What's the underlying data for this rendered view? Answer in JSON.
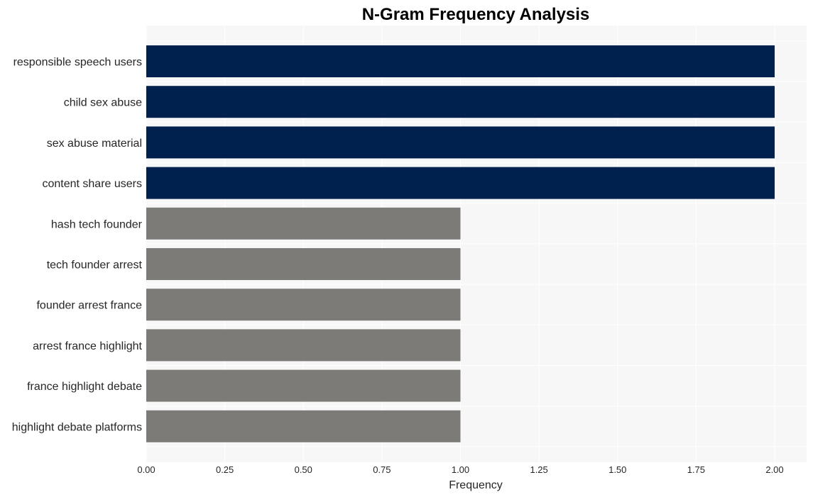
{
  "chart_data": {
    "type": "bar",
    "orientation": "horizontal",
    "title": "N-Gram Frequency Analysis",
    "xlabel": "Frequency",
    "ylabel": "",
    "xlim": [
      0,
      2.1
    ],
    "xticks": [
      0,
      0.25,
      0.5,
      0.75,
      1.0,
      1.25,
      1.5,
      1.75,
      2.0
    ],
    "xtick_labels": [
      "0.00",
      "0.25",
      "0.50",
      "0.75",
      "1.00",
      "1.25",
      "1.50",
      "1.75",
      "2.00"
    ],
    "grid": true,
    "categories": [
      "responsible speech users",
      "child sex abuse",
      "sex abuse material",
      "content share users",
      "hash tech founder",
      "tech founder arrest",
      "founder arrest france",
      "arrest france highlight",
      "france highlight debate",
      "highlight debate platforms"
    ],
    "values": [
      2,
      2,
      2,
      2,
      1,
      1,
      1,
      1,
      1,
      1
    ],
    "colors": {
      "high": "#00204e",
      "low": "#7c7b78",
      "plot_background": "#f7f7f7",
      "grid": "#ffffff"
    }
  }
}
